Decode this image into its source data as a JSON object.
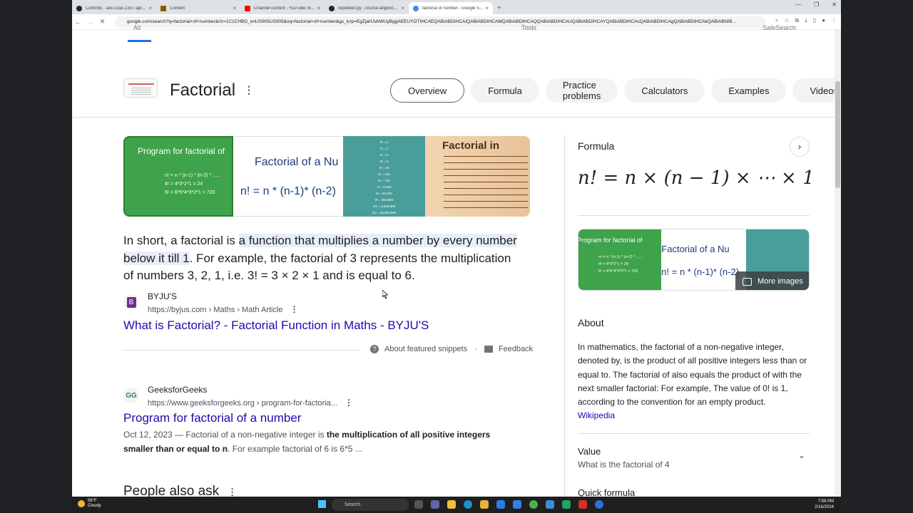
{
  "browser": {
    "tabs": [
      {
        "label": "Commits · aoc-ccac-1337-apr...",
        "icon": "github-icon"
      },
      {
        "label": "Content",
        "icon": "content-icon"
      },
      {
        "label": "Channel content - YouTube St...",
        "icon": "youtube-icon"
      },
      {
        "label": "repetition.py - course-artgonz...",
        "icon": "github-icon"
      },
      {
        "label": "factorial of number - Google S...",
        "icon": "google-icon",
        "active": true
      }
    ],
    "url": "google.com/search?q=factorial+of+number&rlz=1C1CHBD_enUS905US905&oq=factorial+of+number&gs_lcrp=EgZjaHJvbWUyBggAEEUYOTIHCAEQABiABDIHCAIQABiABDIHCAMQABiABDIHCAQQABiABDIHCAUQABiABDIHCAYQABiABDIHCAcQABiABDIHCAgQABiABDIHCAkQABiABNIB..."
  },
  "google": {
    "results_tabs": "All",
    "right_link": "SafeSearch",
    "tools": "Tools"
  },
  "entity": {
    "title": "Factorial",
    "chips": [
      "Overview",
      "Formula",
      "Practice problems",
      "Calculators",
      "Examples",
      "Videos"
    ]
  },
  "images": {
    "img1_title": "Program for factorial of",
    "img1_formula": [
      "n! = n * (n-1) * (n-2) * ......",
      "4! = 4*3*2*1 = 24",
      "6! = 6*5*4*3*2*1 = 720"
    ],
    "img2_title": "Factorial of a Nu",
    "img2_formula": "n! = n * (n-1)* (n-2)",
    "img3_lines": [
      "0! = 1",
      "1! = 1",
      "2! = 2",
      "3! = 6",
      "4! = 24",
      "5! = 120",
      "6! = 720",
      "7! = 5,040",
      "8! = 40,320",
      "9! = 362,880",
      "10! = 3,628,800",
      "11! = 39,916,800",
      "12! = 479,001,600"
    ],
    "img4_title": "Factorial in"
  },
  "snippet": {
    "prefix": "In short, a factorial is ",
    "highlight": "a function that multiplies a number by every number below it till 1",
    "suffix": ". For example, the factorial of 3 represents the multiplication of numbers 3, 2, 1, i.e. 3! = 3 × 2 × 1 and is equal to 6.",
    "source_name": "BYJU'S",
    "source_url": "https://byjus.com › Maths › Math Article",
    "link_title": "What is Factorial? - Factorial Function in Maths - BYJU'S",
    "about_snippets": "About featured snippets",
    "dot": "·",
    "feedback": "Feedback"
  },
  "result2": {
    "source_name": "GeeksforGeeks",
    "source_url": "https://www.geeksforgeeks.org › program-for-factoria...",
    "link_title": "Program for factorial of a number",
    "date": "Oct 12, 2023",
    "desc_a": " — Factorial of a non-negative integer is ",
    "desc_bold": "the multiplication of all positive integers smaller than or equal to n",
    "desc_b": ". For example factorial of 6 is 6*5 ..."
  },
  "people_also_ask": "People also ask",
  "knowledge_panel": {
    "formula_heading": "Formula",
    "formula": "n! = n × (n − 1) × ⋯ × 1",
    "more_images": "More images",
    "about_heading": "About",
    "about_text": "In mathematics, the factorial of a non-negative integer, denoted by, is the product of all positive integers less than or equal to. The factorial of also equals the product of with the next smaller factorial: For example, The value of 0! is 1, according to the convention for an empty product.",
    "wikipedia": "Wikipedia",
    "value_heading": "Value",
    "value_sub": "What is the factorial of 4",
    "quick_formula": "Quick formula"
  },
  "taskbar": {
    "temp": "56°F",
    "weather": "Cloudy",
    "search": "Search",
    "time": "7:59 PM",
    "date": "2/16/2024"
  }
}
